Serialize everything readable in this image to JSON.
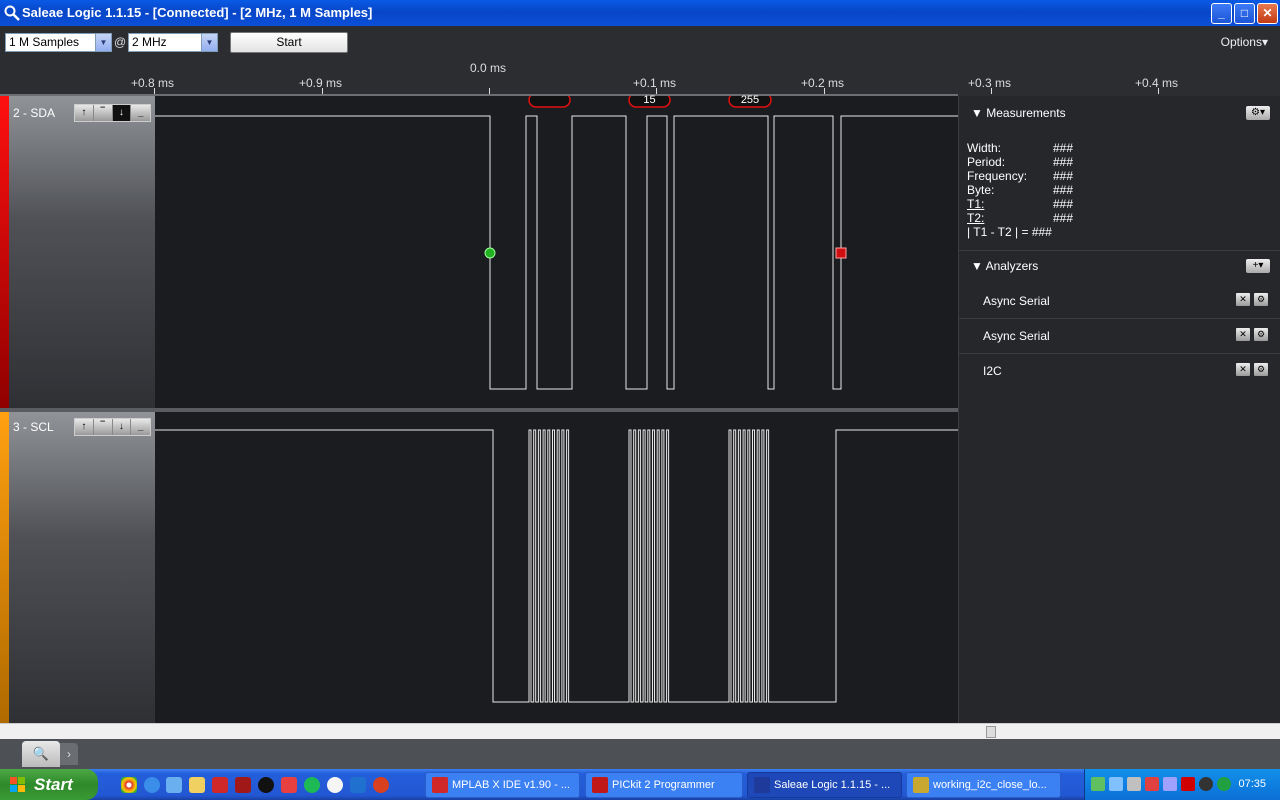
{
  "window": {
    "title": "Saleae Logic 1.1.15 - [Connected] - [2 MHz, 1 M Samples]",
    "min": "_",
    "max": "□",
    "close": "✕"
  },
  "toolbar": {
    "samples_value": "1 M Samples",
    "at_sign": "@",
    "rate_value": "2 MHz",
    "start_label": "Start",
    "options_label": "Options▾"
  },
  "ruler": {
    "ticks": [
      "+0.8 ms",
      "+0.9 ms",
      "0.0 ms",
      "+0.1 ms",
      "+0.2 ms",
      "+0.3 ms",
      "+0.4 ms"
    ]
  },
  "channels": [
    {
      "label": "2 - SDA",
      "color": "#e8000f",
      "bubbles": [
        "",
        "15",
        "255"
      ]
    },
    {
      "label": "3 - SCL",
      "color": "#f09a00"
    }
  ],
  "measurements": {
    "title": "Measurements",
    "rows": [
      {
        "label": "Width:",
        "value": "###"
      },
      {
        "label": "Period:",
        "value": "###"
      },
      {
        "label": "Frequency:",
        "value": "###"
      },
      {
        "label": "Byte:",
        "value": "###"
      },
      {
        "label": "T1:",
        "value": "###"
      },
      {
        "label": "T2:",
        "value": "###"
      },
      {
        "label": "| T1 - T2 | = ###",
        "value": ""
      }
    ]
  },
  "analyzers": {
    "title": "Analyzers",
    "items": [
      "Async Serial",
      "Async Serial",
      "I2C"
    ]
  },
  "taskbar": {
    "start": "Start",
    "tasks": [
      {
        "label": "MPLAB X IDE v1.90 - ...",
        "icon_color": "#d02828"
      },
      {
        "label": "PICkit 2 Programmer",
        "icon_color": "#c01818"
      },
      {
        "label": "Saleae Logic 1.1.15 - ...",
        "icon_color": "#1e3a9a"
      },
      {
        "label": "working_i2c_close_lo...",
        "icon_color": "#c8a830"
      }
    ],
    "clock": "07:35"
  }
}
